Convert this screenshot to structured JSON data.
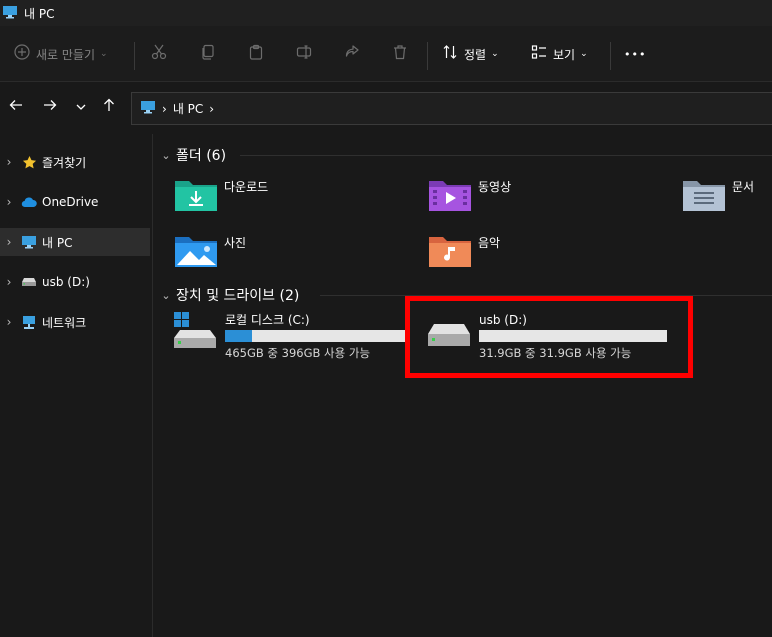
{
  "window": {
    "title": "내 PC"
  },
  "toolbar": {
    "new_label": "새로 만들기",
    "sort_label": "정렬",
    "view_label": "보기",
    "more_label": "•••"
  },
  "address": {
    "crumb": "내 PC"
  },
  "sidebar": {
    "items": [
      {
        "label": "즐겨찾기"
      },
      {
        "label": "OneDrive"
      },
      {
        "label": "내 PC"
      },
      {
        "label": "usb (D:)"
      },
      {
        "label": "네트워크"
      }
    ]
  },
  "folders_section": {
    "header": "폴더 (6)",
    "items": [
      {
        "label": "다운로드"
      },
      {
        "label": "동영상"
      },
      {
        "label": "문서"
      },
      {
        "label": "사진"
      },
      {
        "label": "음악"
      }
    ]
  },
  "drives_section": {
    "header": "장치 및 드라이브 (2)",
    "drives": [
      {
        "name": "로컬 디스크 (C:)",
        "free_text": "465GB 중 396GB 사용 가능",
        "used_fraction": 0.15
      },
      {
        "name": "usb (D:)",
        "free_text": "31.9GB 중 31.9GB 사용 가능",
        "used_fraction": 0.0
      }
    ]
  },
  "colors": {
    "accent": "#2b8fd6",
    "highlight": "#ff0000"
  }
}
